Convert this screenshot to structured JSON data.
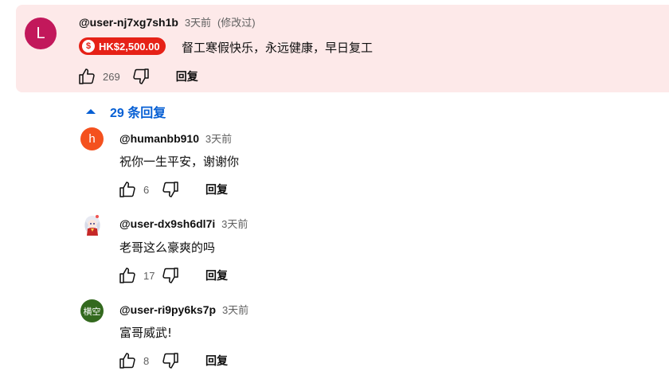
{
  "main_comment": {
    "avatar_letter": "L",
    "avatar_color": "#c2185b",
    "author": "@user-nj7xg7sh1b",
    "time": "3天前",
    "edited": "(修改过)",
    "donation_amount": "HK$2,500.00",
    "donation_icon": "dollar-coin-icon",
    "text": "督工寒假快乐，永远健康，早日复工",
    "likes": "269",
    "reply_label": "回复"
  },
  "replies_toggle": {
    "label": "29 条回复",
    "icon": "chevron-up-icon"
  },
  "replies": [
    {
      "avatar_letter": "h",
      "avatar_color": "#f4511e",
      "author": "@humanbb910",
      "time": "3天前",
      "text": "祝你一生平安，谢谢你",
      "likes": "6",
      "reply_label": "回复"
    },
    {
      "avatar_letter": "",
      "avatar_color": "#ffffff",
      "author": "@user-dx9sh6dl7i",
      "time": "3天前",
      "text": "老哥这么豪爽的吗",
      "likes": "17",
      "reply_label": "回复"
    },
    {
      "avatar_letter": "横空",
      "avatar_color": "#33691e",
      "author": "@user-ri9py6ks7p",
      "time": "3天前",
      "text": "富哥威武!",
      "likes": "8",
      "reply_label": "回复"
    }
  ]
}
